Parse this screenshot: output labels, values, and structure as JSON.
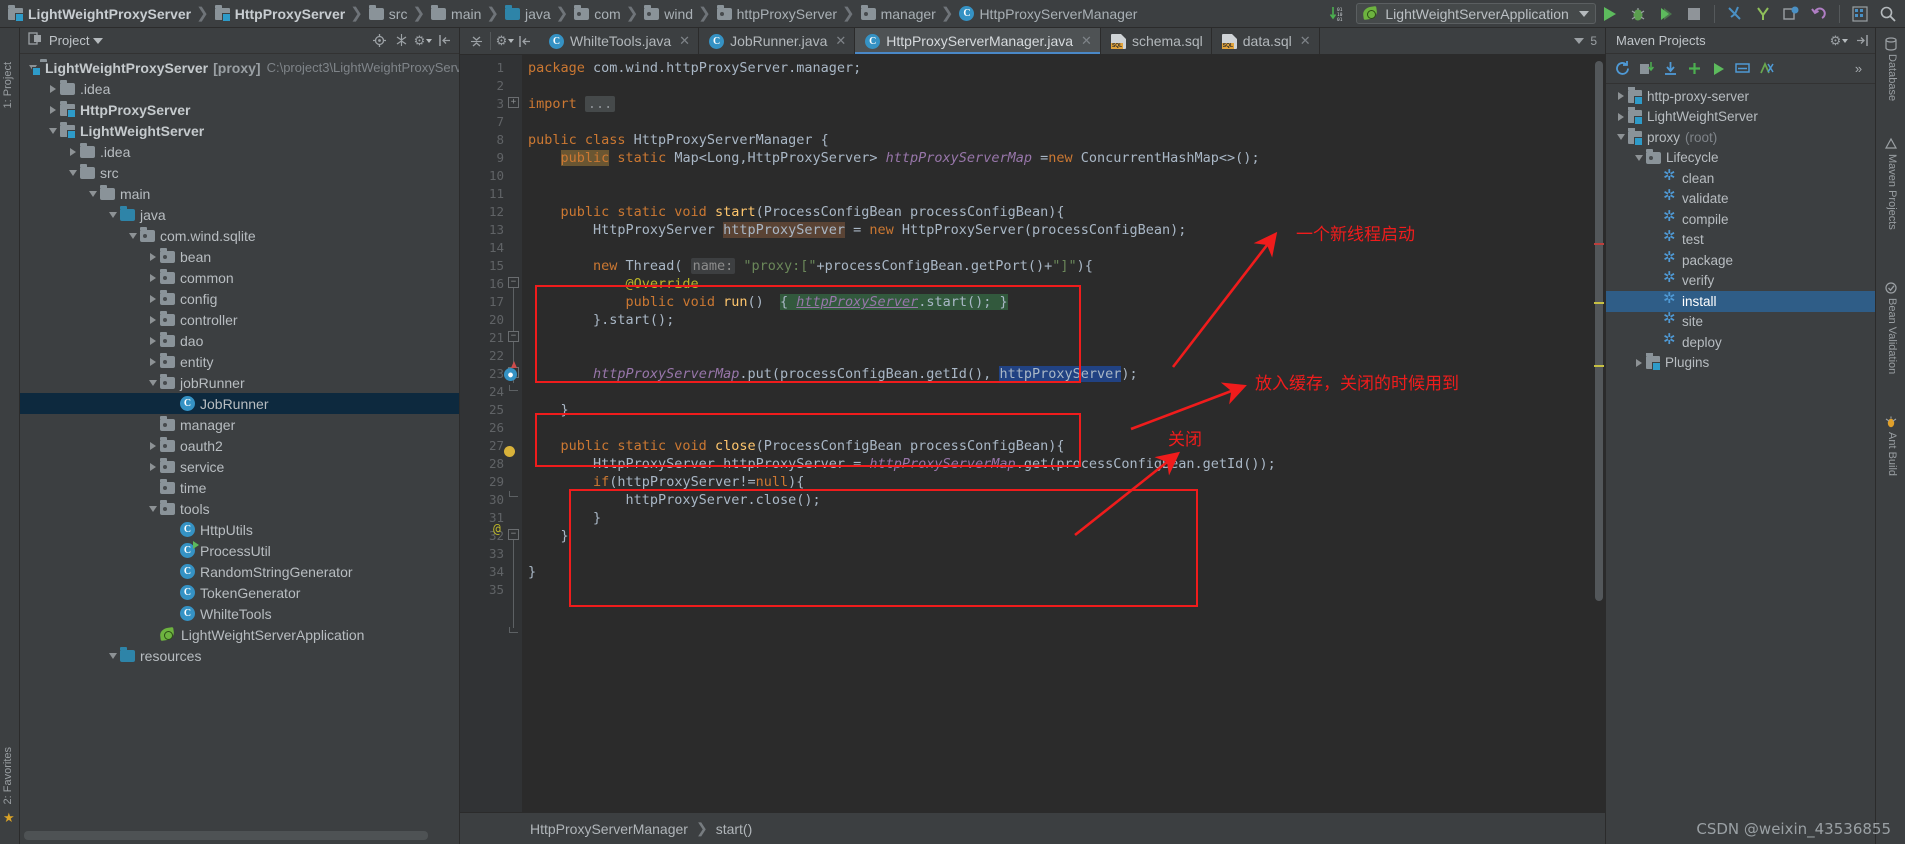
{
  "breadcrumb": {
    "items": [
      {
        "label": "LightWeightProxyServer",
        "icon": "module-icon",
        "bold": true
      },
      {
        "label": "HttpProxyServer",
        "icon": "module-icon",
        "bold": true
      },
      {
        "label": "src",
        "icon": "folder-icon",
        "bold": false
      },
      {
        "label": "main",
        "icon": "folder-icon",
        "bold": false
      },
      {
        "label": "java",
        "icon": "folder-source-icon",
        "bold": false
      },
      {
        "label": "com",
        "icon": "package-icon",
        "bold": false
      },
      {
        "label": "wind",
        "icon": "package-icon",
        "bold": false
      },
      {
        "label": "httpProxyServer",
        "icon": "package-icon",
        "bold": false
      },
      {
        "label": "manager",
        "icon": "package-icon",
        "bold": false
      },
      {
        "label": "HttpProxyServerManager",
        "icon": "class-icon",
        "bold": false
      }
    ]
  },
  "toolbar": {
    "run_configuration": "LightWeightServerApplication",
    "icons": [
      "navigate-bytecode-icon",
      "run-icon",
      "debug-icon",
      "run-coverage-icon",
      "stop-icon",
      "build-icon",
      "update-icon",
      "database-sync-icon",
      "revert-icon",
      "layout-icon",
      "search-everywhere-icon"
    ]
  },
  "project_panel": {
    "title": "Project",
    "rail_label": "1: Project",
    "favorites_rail_label": "2: Favorites",
    "header_icons": [
      "locate-icon",
      "collapse-all-icon",
      "settings-icon",
      "hide-icon"
    ],
    "tree": [
      {
        "depth": 0,
        "label": "LightWeightProxyServer",
        "tag": "[proxy]",
        "path": "C:\\project3\\LightWeightProxyServ",
        "icon": "module-icon",
        "toggle": "expanded",
        "bold": true
      },
      {
        "depth": 1,
        "label": ".idea",
        "icon": "folder-icon",
        "toggle": "collapsed",
        "bold": false
      },
      {
        "depth": 1,
        "label": "HttpProxyServer",
        "icon": "module-icon",
        "toggle": "collapsed",
        "bold": true
      },
      {
        "depth": 1,
        "label": "LightWeightServer",
        "icon": "module-icon",
        "toggle": "expanded",
        "bold": true
      },
      {
        "depth": 2,
        "label": ".idea",
        "icon": "folder-icon",
        "toggle": "collapsed",
        "bold": false
      },
      {
        "depth": 2,
        "label": "src",
        "icon": "folder-icon",
        "toggle": "expanded",
        "bold": false
      },
      {
        "depth": 3,
        "label": "main",
        "icon": "folder-icon",
        "toggle": "expanded",
        "bold": false
      },
      {
        "depth": 4,
        "label": "java",
        "icon": "folder-source-icon",
        "toggle": "expanded",
        "bold": false
      },
      {
        "depth": 5,
        "label": "com.wind.sqlite",
        "icon": "package-icon",
        "toggle": "expanded",
        "bold": false
      },
      {
        "depth": 6,
        "label": "bean",
        "icon": "package-icon",
        "toggle": "collapsed",
        "bold": false
      },
      {
        "depth": 6,
        "label": "common",
        "icon": "package-icon",
        "toggle": "collapsed",
        "bold": false
      },
      {
        "depth": 6,
        "label": "config",
        "icon": "package-icon",
        "toggle": "collapsed",
        "bold": false
      },
      {
        "depth": 6,
        "label": "controller",
        "icon": "package-icon",
        "toggle": "collapsed",
        "bold": false
      },
      {
        "depth": 6,
        "label": "dao",
        "icon": "package-icon",
        "toggle": "collapsed",
        "bold": false
      },
      {
        "depth": 6,
        "label": "entity",
        "icon": "package-icon",
        "toggle": "collapsed",
        "bold": false
      },
      {
        "depth": 6,
        "label": "jobRunner",
        "icon": "package-icon",
        "toggle": "expanded",
        "bold": false
      },
      {
        "depth": 7,
        "label": "JobRunner",
        "icon": "class-icon",
        "toggle": "none",
        "bold": false,
        "selected": true
      },
      {
        "depth": 6,
        "label": "manager",
        "icon": "package-icon",
        "toggle": "none",
        "bold": false
      },
      {
        "depth": 6,
        "label": "oauth2",
        "icon": "package-icon",
        "toggle": "collapsed",
        "bold": false
      },
      {
        "depth": 6,
        "label": "service",
        "icon": "package-icon",
        "toggle": "collapsed",
        "bold": false
      },
      {
        "depth": 6,
        "label": "time",
        "icon": "package-icon",
        "toggle": "none",
        "bold": false
      },
      {
        "depth": 6,
        "label": "tools",
        "icon": "package-icon",
        "toggle": "expanded",
        "bold": false
      },
      {
        "depth": 7,
        "label": "HttpUtils",
        "icon": "class-icon",
        "toggle": "none",
        "bold": false
      },
      {
        "depth": 7,
        "label": "ProcessUtil",
        "icon": "class-runnable-icon",
        "toggle": "none",
        "bold": false
      },
      {
        "depth": 7,
        "label": "RandomStringGenerator",
        "icon": "class-icon",
        "toggle": "none",
        "bold": false
      },
      {
        "depth": 7,
        "label": "TokenGenerator",
        "icon": "class-icon",
        "toggle": "none",
        "bold": false
      },
      {
        "depth": 7,
        "label": "WhilteTools",
        "icon": "class-icon",
        "toggle": "none",
        "bold": false
      },
      {
        "depth": 6,
        "label": "LightWeightServerApplication",
        "icon": "spring-boot-icon",
        "toggle": "none",
        "bold": false
      },
      {
        "depth": 4,
        "label": "resources",
        "icon": "folder-resources-icon",
        "toggle": "expanded",
        "bold": false
      }
    ]
  },
  "editor": {
    "tabs": [
      {
        "label": "WhilteTools.java",
        "icon": "class-icon",
        "active": false,
        "closable": true
      },
      {
        "label": "JobRunner.java",
        "icon": "class-icon",
        "active": false,
        "closable": true
      },
      {
        "label": "HttpProxyServerManager.java",
        "icon": "class-icon",
        "active": true,
        "closable": true
      },
      {
        "label": "schema.sql",
        "icon": "sql-icon",
        "active": false,
        "closable": false
      },
      {
        "label": "data.sql",
        "icon": "sql-icon",
        "active": false,
        "closable": true
      }
    ],
    "tabs_overflow_count": "5",
    "breadcrumb_bottom": [
      "HttpProxyServerManager",
      "start()"
    ],
    "line_numbers": [
      "1",
      "2",
      "3",
      "7",
      "8",
      "9",
      "10",
      "11",
      "12",
      "13",
      "14",
      "15",
      "16",
      "17",
      "20",
      "21",
      "22",
      "23",
      "24",
      "25",
      "26",
      "27",
      "28",
      "29",
      "30",
      "31",
      "32",
      "33",
      "34",
      "35"
    ],
    "code_lines": [
      "package com.wind.httpProxyServer.manager;",
      "",
      "import ...",
      "",
      "public class HttpProxyServerManager {",
      "    public static Map<Long,HttpProxyServer> httpProxyServerMap =new ConcurrentHashMap<>();",
      "",
      "",
      "    public static void start(ProcessConfigBean processConfigBean){",
      "        HttpProxyServer httpProxyServer = new HttpProxyServer(processConfigBean);",
      "",
      "        new Thread( name: \"proxy:[\"+processConfigBean.getPort()+\"]\"){",
      "            @Override",
      "            public void run()  { httpProxyServer.start(); }",
      "        }.start();",
      "",
      "",
      "        httpProxyServerMap.put(processConfigBean.getId(), httpProxyServer);",
      "",
      "    }",
      "",
      "    public static void close(ProcessConfigBean processConfigBean){",
      "        HttpProxyServer httpProxyServer = httpProxyServerMap.get(processConfigBean.getId());",
      "        if(httpProxyServer!=null){",
      "            httpProxyServer.close();",
      "        }",
      "    }",
      "",
      "}",
      ""
    ]
  },
  "annotations": [
    {
      "text": "一个新线程启动",
      "name": "annotation-new-thread"
    },
    {
      "text": "放入缓存，关闭的时候用到",
      "name": "annotation-put-cache"
    },
    {
      "text": "关闭",
      "name": "annotation-close"
    }
  ],
  "maven_panel": {
    "title": "Maven Projects",
    "toolbar_icons": [
      "reimport-icon",
      "generate-sources-icon",
      "download-sources-icon",
      "add-maven-project-icon",
      "run-icon",
      "toggle-offline-icon",
      "skip-tests-icon",
      "more-icon"
    ],
    "tree": [
      {
        "depth": 0,
        "label": "http-proxy-server",
        "icon": "maven-module-icon",
        "toggle": "collapsed"
      },
      {
        "depth": 0,
        "label": "LightWeightServer",
        "icon": "maven-module-icon",
        "toggle": "collapsed"
      },
      {
        "depth": 0,
        "label": "proxy",
        "suffix": "(root)",
        "icon": "maven-module-icon",
        "toggle": "expanded"
      },
      {
        "depth": 1,
        "label": "Lifecycle",
        "icon": "lifecycle-icon",
        "toggle": "expanded"
      },
      {
        "depth": 2,
        "label": "clean",
        "icon": "goal-icon",
        "toggle": "none"
      },
      {
        "depth": 2,
        "label": "validate",
        "icon": "goal-icon",
        "toggle": "none"
      },
      {
        "depth": 2,
        "label": "compile",
        "icon": "goal-icon",
        "toggle": "none"
      },
      {
        "depth": 2,
        "label": "test",
        "icon": "goal-icon",
        "toggle": "none"
      },
      {
        "depth": 2,
        "label": "package",
        "icon": "goal-icon",
        "toggle": "none"
      },
      {
        "depth": 2,
        "label": "verify",
        "icon": "goal-icon",
        "toggle": "none"
      },
      {
        "depth": 2,
        "label": "install",
        "icon": "goal-icon",
        "toggle": "none",
        "selected": true
      },
      {
        "depth": 2,
        "label": "site",
        "icon": "goal-icon",
        "toggle": "none"
      },
      {
        "depth": 2,
        "label": "deploy",
        "icon": "goal-icon",
        "toggle": "none"
      },
      {
        "depth": 1,
        "label": "Plugins",
        "icon": "plugins-icon",
        "toggle": "collapsed"
      }
    ]
  },
  "right_rail": {
    "items": [
      "Database",
      "Maven Projects",
      "Bean Validation",
      "Ant Build"
    ]
  },
  "watermark": "CSDN @weixin_43536855",
  "colors": {
    "accent": "#3592c4",
    "annotation_red": "#f01c1c",
    "selection_blue": "#0d293e",
    "maven_selection": "#2f5d87"
  }
}
